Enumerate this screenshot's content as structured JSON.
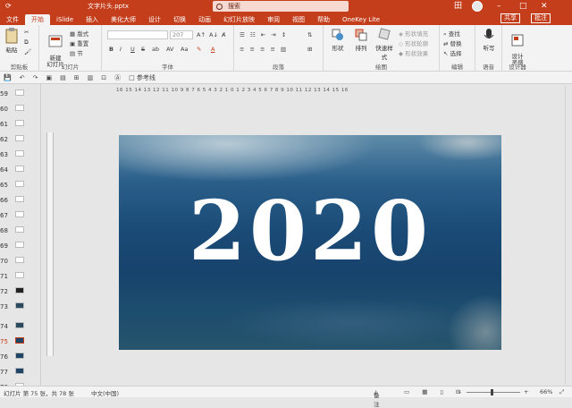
{
  "app": {
    "file_name": "文字片头.pptx",
    "search_placeholder": "搜索",
    "win_controls": [
      "田",
      "–",
      "□",
      "✕"
    ]
  },
  "tabs": [
    {
      "label": "文件"
    },
    {
      "label": "开始",
      "active": true
    },
    {
      "label": "iSlide"
    },
    {
      "label": "插入"
    },
    {
      "label": "美化大师"
    },
    {
      "label": "设计"
    },
    {
      "label": "切换"
    },
    {
      "label": "动画"
    },
    {
      "label": "幻灯片放映"
    },
    {
      "label": "审阅"
    },
    {
      "label": "视图"
    },
    {
      "label": "帮助"
    },
    {
      "label": "OneKey Lite"
    }
  ],
  "share": {
    "share_label": "共享",
    "comment_label": "批注"
  },
  "ribbon": {
    "clipboard": {
      "label": "剪贴板",
      "paste": "粘贴"
    },
    "slides": {
      "label": "幻灯片",
      "new_slide": "新建\n幻灯片",
      "layout": "版式",
      "reset": "重置",
      "section": "节"
    },
    "font": {
      "label": "字体",
      "size": "207",
      "buttons": [
        "B",
        "I",
        "U",
        "S",
        "ab",
        "AV",
        "Aa"
      ]
    },
    "paragraph": {
      "label": "段落"
    },
    "drawing": {
      "label": "绘图",
      "shape": "形状",
      "arrange": "排列",
      "quick_styles": "快速样式",
      "fill": "形状填充",
      "outline": "形状轮廓",
      "effects": "形状效果"
    },
    "editing": {
      "label": "编辑",
      "find": "查找",
      "replace": "替换",
      "select": "选择"
    },
    "voice": {
      "label": "语音",
      "dictate": "听写"
    },
    "designer": {
      "label": "设计器",
      "design_ideas": "设计\n灵感"
    }
  },
  "qat": {
    "items": [
      "💾",
      "↶",
      "↷",
      "▣",
      "▤",
      "⊞",
      "▥",
      "⊡",
      "Ⓐ",
      "□ 参考线"
    ]
  },
  "thumbs": [
    {
      "num": "59"
    },
    {
      "num": "60"
    },
    {
      "num": "61"
    },
    {
      "num": "62"
    },
    {
      "num": "63"
    },
    {
      "num": "64"
    },
    {
      "num": "65"
    },
    {
      "num": "66"
    },
    {
      "num": "67"
    },
    {
      "num": "68"
    },
    {
      "num": "69"
    },
    {
      "num": "70"
    },
    {
      "num": "71"
    },
    {
      "num": "72"
    },
    {
      "num": "73"
    },
    {
      "num": "74"
    },
    {
      "num": "75",
      "selected": true
    },
    {
      "num": "76"
    },
    {
      "num": "77"
    },
    {
      "num": "78"
    }
  ],
  "ruler": {
    "h": "16 15 14 13 12 11 10 9 8 7 6 5 4 3 2 1 0 1 2 3 4 5 6 7 8 9 10 11 12 13 14 15 16"
  },
  "slide": {
    "year": "2020"
  },
  "status": {
    "slide_info": "幻灯片 第 75 张，共 78 张",
    "language": "中文(中国)",
    "notes": "备注",
    "zoom": "66%"
  }
}
